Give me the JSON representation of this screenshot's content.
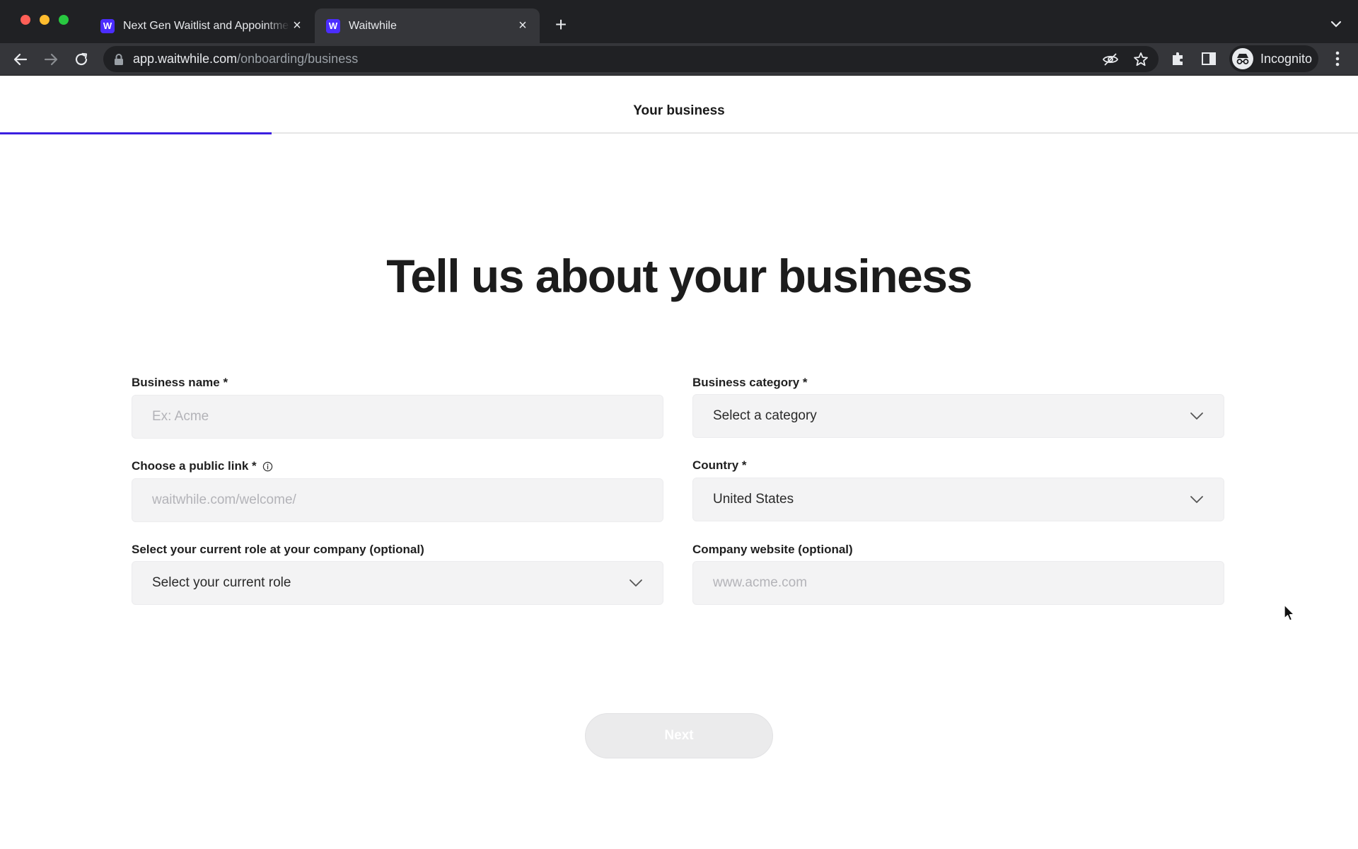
{
  "browser": {
    "tabs": [
      {
        "title": "Next Gen Waitlist and Appointment",
        "favicon": "W",
        "active": false
      },
      {
        "title": "Waitwhile",
        "favicon": "W",
        "active": true
      }
    ],
    "new_tab_label": "+",
    "close_glyph": "×",
    "url_host": "app.waitwhile.com",
    "url_path": "/onboarding/business",
    "profile_label": "Incognito"
  },
  "step": {
    "title": "Your business",
    "progress": 0.2
  },
  "form": {
    "heading": "Tell us about your business",
    "business_name": {
      "label": "Business name *",
      "placeholder": "Ex: Acme",
      "value": ""
    },
    "business_category": {
      "label": "Business category *",
      "value": "Select a category"
    },
    "public_link": {
      "label": "Choose a public link *",
      "placeholder": "waitwhile.com/welcome/",
      "value": ""
    },
    "country": {
      "label": "Country *",
      "value": "United States"
    },
    "role": {
      "label": "Select your current role at your company (optional)",
      "value": "Select your current role"
    },
    "website": {
      "label": "Company website (optional)",
      "placeholder": "www.acme.com",
      "value": ""
    },
    "next_label": "Next"
  },
  "colors": {
    "accent": "#3b1ee0",
    "favicon": "#4b2dff",
    "chrome_dark": "#202124",
    "chrome_mid": "#35363a"
  }
}
